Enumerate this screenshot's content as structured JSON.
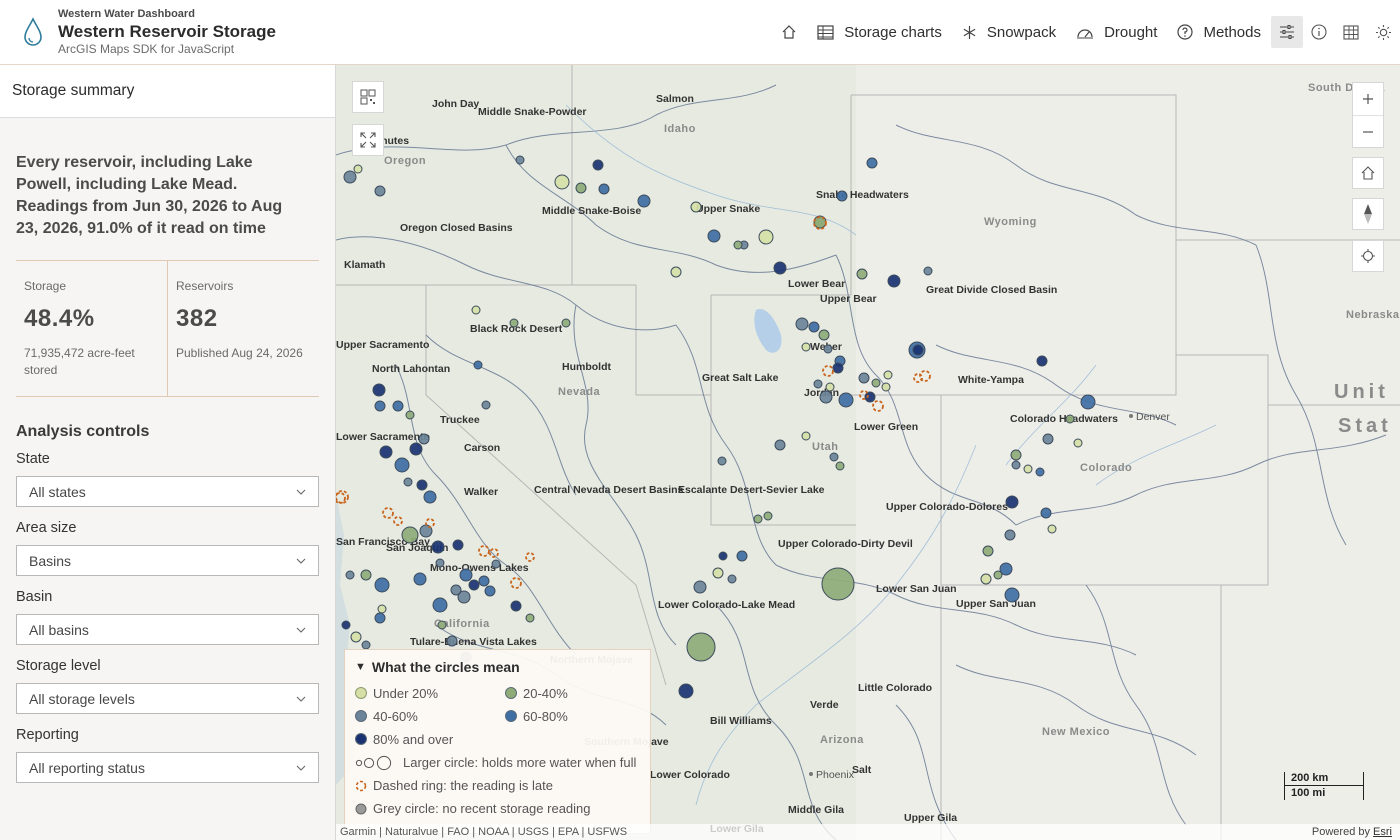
{
  "header": {
    "kicker": "Western Water Dashboard",
    "title": "Western Reservoir Storage",
    "subtitle": "ArcGIS Maps SDK for JavaScript",
    "nav": [
      {
        "label": "",
        "icon": "home-icon"
      },
      {
        "label": "Storage charts",
        "icon": "table-icon"
      },
      {
        "label": "Snowpack",
        "icon": "snowflake-icon"
      },
      {
        "label": "Drought",
        "icon": "gauge-icon"
      },
      {
        "label": "Methods",
        "icon": "question-icon"
      }
    ],
    "tools": [
      "sliders-icon",
      "info-icon",
      "grid-icon",
      "sun-icon"
    ]
  },
  "panel": {
    "heading": "Storage summary",
    "summary": "Every reservoir, including Lake Powell, including Lake Mead. Readings from Jun 30, 2026 to Aug 23, 2026, 91.0% of it read on time",
    "stats": [
      {
        "label": "Storage",
        "value": "48.4%",
        "note": "71,935,472 acre-feet stored"
      },
      {
        "label": "Reservoirs",
        "value": "382",
        "note": "Published Aug 24, 2026"
      }
    ],
    "controls_title": "Analysis controls",
    "controls": [
      {
        "label": "State",
        "value": "All states"
      },
      {
        "label": "Area size",
        "value": "Basins"
      },
      {
        "label": "Basin",
        "value": "All basins"
      },
      {
        "label": "Storage level",
        "value": "All storage levels"
      },
      {
        "label": "Reporting",
        "value": "All reporting status"
      }
    ]
  },
  "map": {
    "labels": [
      {
        "t": "John Day"
      },
      {
        "t": "Salmon"
      },
      {
        "t": "Middle Snake-Powder"
      },
      {
        "t": "Deschutes"
      },
      {
        "t": "Middle Snake-Boise"
      },
      {
        "t": "Upper Snake"
      },
      {
        "t": "Snake Headwaters"
      },
      {
        "t": "Oregon Closed Basins"
      },
      {
        "t": "Klamath"
      },
      {
        "t": "Lower Bear"
      },
      {
        "t": "Upper Bear"
      },
      {
        "t": "Great Divide Closed Basin"
      },
      {
        "t": "Black Rock Desert"
      },
      {
        "t": "Upper Sacramento"
      },
      {
        "t": "North Lahontan"
      },
      {
        "t": "Humboldt"
      },
      {
        "t": "Weber"
      },
      {
        "t": "Great Salt Lake"
      },
      {
        "t": "Jordan"
      },
      {
        "t": "White-Yampa"
      },
      {
        "t": "Colorado Headwaters"
      },
      {
        "t": "Lower Sacramento"
      },
      {
        "t": "Truckee"
      },
      {
        "t": "Carson"
      },
      {
        "t": "Lower Green"
      },
      {
        "t": "Walker"
      },
      {
        "t": "Central Nevada Desert Basins"
      },
      {
        "t": "Escalante Desert-Sevier Lake"
      },
      {
        "t": "Upper Colorado-Dolores"
      },
      {
        "t": "San Francisco Bay"
      },
      {
        "t": "San Joaquin"
      },
      {
        "t": "Upper Colorado-Dirty Devil"
      },
      {
        "t": "Mono-Owens Lakes"
      },
      {
        "t": "Lower Colorado-Lake Mead"
      },
      {
        "t": "Lower San Juan"
      },
      {
        "t": "Upper San Juan"
      },
      {
        "t": "Tulare-Buena Vista Lakes"
      },
      {
        "t": "Northern Mojave"
      },
      {
        "t": "Little Colorado"
      },
      {
        "t": "Bill Williams"
      },
      {
        "t": "Verde"
      },
      {
        "t": "Salt"
      },
      {
        "t": "Lower Colorado"
      },
      {
        "t": "Middle Gila"
      },
      {
        "t": "Upper Gila"
      },
      {
        "t": "Lower Gila"
      },
      {
        "t": "Southern Mojave"
      }
    ],
    "states": [
      "Idaho",
      "Oregon",
      "Nevada",
      "Wyoming",
      "Utah",
      "Colorado",
      "California",
      "Arizona",
      "New Mexico",
      "Nebraska",
      "South Dakota"
    ],
    "cities": [
      "Denver",
      "Phoenix"
    ],
    "country": [
      "Unit",
      "Stat"
    ],
    "legend": {
      "title": "What the circles mean",
      "classes": [
        {
          "label": "Under 20%",
          "color": "#d6dfa6"
        },
        {
          "label": "20-40%",
          "color": "#8fab78"
        },
        {
          "label": "40-60%",
          "color": "#6b8499"
        },
        {
          "label": "60-80%",
          "color": "#3f6ea4"
        },
        {
          "label": "80% and over",
          "color": "#1a3272"
        }
      ],
      "size_note": "Larger circle: holds more water when full",
      "late_note": "Dashed ring: the reading is late",
      "grey_note": "Grey circle: no recent storage reading"
    },
    "scale": {
      "km": "200 km",
      "mi": "100 mi"
    },
    "attribution": "Garmin | Naturalvue | FAO | NOAA | USGS | EPA | USFWS",
    "powered": "Powered by",
    "powered_link": "Esri"
  }
}
